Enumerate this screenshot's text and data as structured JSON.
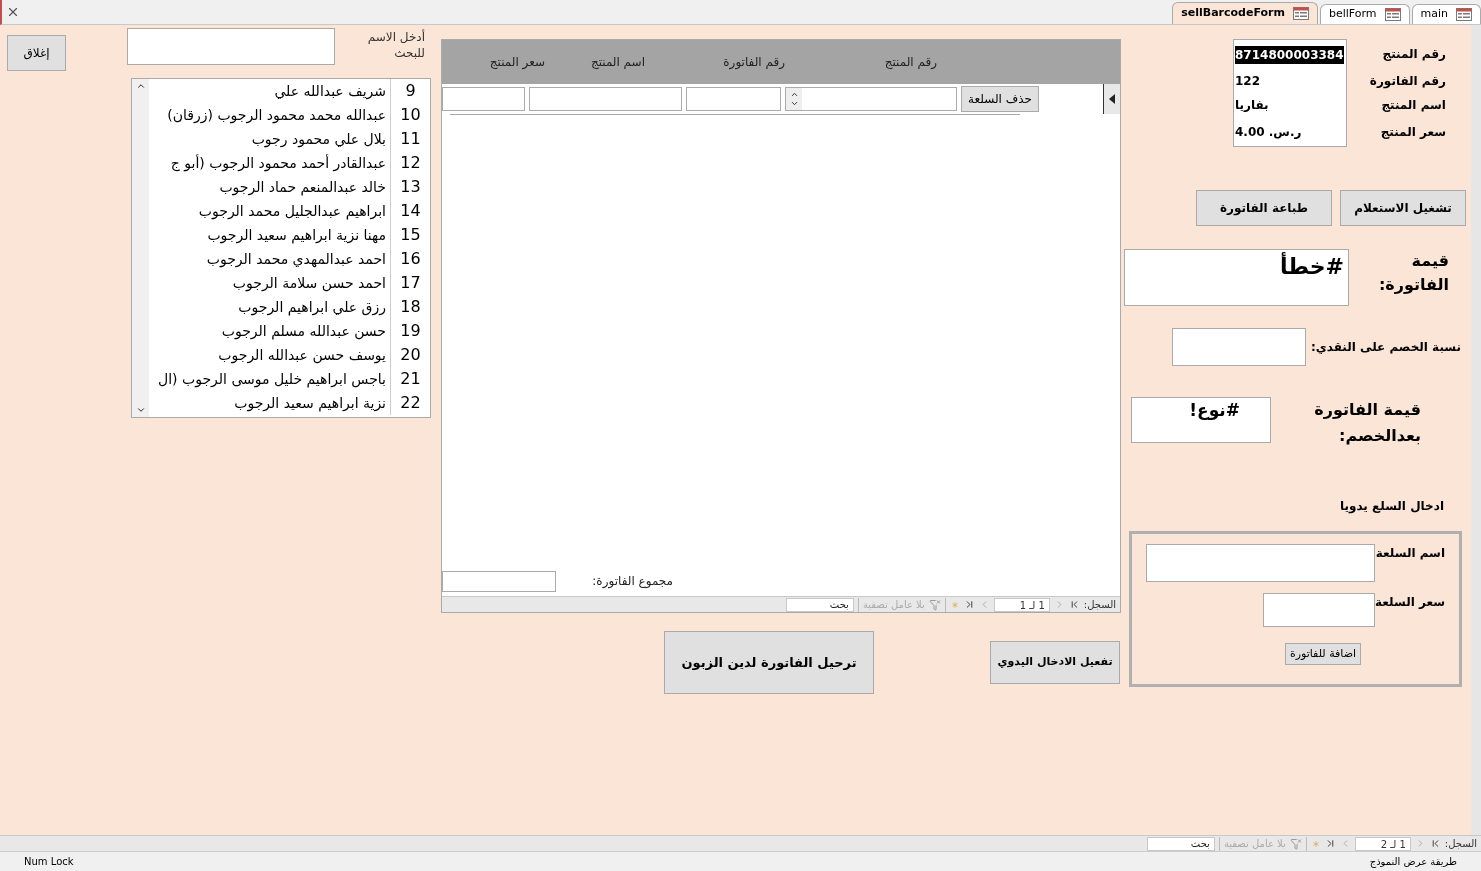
{
  "tabs": [
    {
      "label": "main",
      "selected": false
    },
    {
      "label": "bellForm",
      "selected": false
    },
    {
      "label": "sellBarcodeForm",
      "selected": true
    }
  ],
  "close_button": "إغلاق",
  "search": {
    "label": "أدخل الاسم للبحث"
  },
  "customers": [
    {
      "id": "9",
      "name": "شريف عبدالله علي"
    },
    {
      "id": "10",
      "name": "عبدالله محمد محمود الرجوب (زرقان)"
    },
    {
      "id": "11",
      "name": "بلال علي محمود رجوب"
    },
    {
      "id": "12",
      "name": "عبدالقادر أحمد محمود الرجوب (أبو ج"
    },
    {
      "id": "13",
      "name": "خالد عبدالمنعم حماد الرجوب"
    },
    {
      "id": "14",
      "name": "ابراهيم عبدالجليل محمد الرجوب"
    },
    {
      "id": "15",
      "name": "مهنا نزية ابراهيم سعيد الرجوب"
    },
    {
      "id": "16",
      "name": "احمد عبدالمهدي محمد الرجوب"
    },
    {
      "id": "17",
      "name": "احمد حسن سلامة الرجوب"
    },
    {
      "id": "18",
      "name": "رزق علي ابراهيم الرجوب"
    },
    {
      "id": "19",
      "name": "حسن عبدالله مسلم الرجوب"
    },
    {
      "id": "20",
      "name": "يوسف حسن عبدالله الرجوب"
    },
    {
      "id": "21",
      "name": "باجس ابراهيم خليل موسى الرجوب (ال"
    },
    {
      "id": "22",
      "name": "نزية ابراهيم سعيد الرجوب"
    }
  ],
  "subform": {
    "columns": [
      "رقم المنتج",
      "رقم الفاتورة",
      "اسم المنتج",
      "سعر المنتج"
    ],
    "delete_button": "حذف السلعة",
    "total_label": "مجموع الفاتورة:",
    "record_nav": {
      "label": "السجل:",
      "position": "1 لـ 1",
      "filter": "بلا عامل تصفية",
      "search_placeholder": "بحث"
    }
  },
  "post_button": "ترحيل الفاتورة لدين الزبون",
  "manual_enable_button": "تفعيل الادخال اليدوي",
  "product": [
    {
      "label": "رقم المنتج",
      "value": "8714800003384",
      "highlighted": true
    },
    {
      "label": "رقم الفاتورة",
      "value": "122",
      "highlighted": false
    },
    {
      "label": "اسم المنتج",
      "value": "بفاريا",
      "highlighted": false
    },
    {
      "label": "سعر المنتج",
      "value": "ر.س. 4.00",
      "highlighted": false
    }
  ],
  "run_query_button": "تشغيل الاستعلام",
  "print_button": "طباعة الفاتورة",
  "invoice_value": {
    "label": "قيمة الفاتورة:",
    "value": "#خطأ"
  },
  "discount": {
    "label": "نسبة الخصم على النقدي:"
  },
  "after_discount": {
    "label": "قيمة الفاتورة بعدالخصم:",
    "value": "#نوع!"
  },
  "manual_entry": {
    "title": "ادخال السلع يدويا",
    "name_label": "اسم السلعة",
    "price_label": "سعر السلعة",
    "add_button": "اضافة للفاتورة"
  },
  "record_nav": {
    "label": "السجل:",
    "position": "1 لـ 2",
    "filter": "بلا عامل تصفية",
    "search_placeholder": "بحث"
  },
  "status_bar": {
    "view": "طريقة عرض النموذج",
    "num_lock": "Num Lock"
  }
}
